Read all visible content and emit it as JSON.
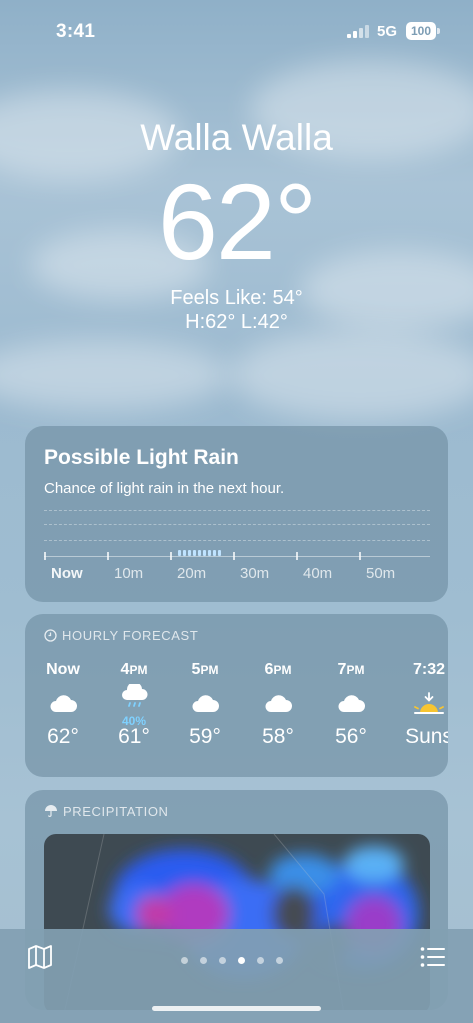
{
  "status": {
    "time": "3:41",
    "network": "5G",
    "battery": "100"
  },
  "location": {
    "city": "Walla Walla",
    "temperature": "62°",
    "feels_like": "Feels Like: 54°",
    "high_low": "H:62°  L:42°"
  },
  "rain_card": {
    "title": "Possible Light Rain",
    "subtitle": "Chance of light rain in the next hour.",
    "axis_labels": [
      "Now",
      "10m",
      "20m",
      "30m",
      "40m",
      "50m"
    ]
  },
  "hourly": {
    "header": "HOURLY FORECAST",
    "items": [
      {
        "time": "Now",
        "icon": "cloud-icon",
        "pop": "",
        "temp": "62°"
      },
      {
        "time": "4PM",
        "icon": "cloud-rain-icon",
        "pop": "40%",
        "temp": "61°"
      },
      {
        "time": "5PM",
        "icon": "cloud-icon",
        "pop": "",
        "temp": "59°"
      },
      {
        "time": "6PM",
        "icon": "cloud-icon",
        "pop": "",
        "temp": "58°"
      },
      {
        "time": "7PM",
        "icon": "cloud-icon",
        "pop": "",
        "temp": "56°"
      },
      {
        "time": "7:32",
        "icon": "sunset-icon",
        "pop": "",
        "temp": "Suns"
      }
    ]
  },
  "precipitation": {
    "header": "PRECIPITATION"
  },
  "pager": {
    "count": 6,
    "active": 3
  },
  "colors": {
    "rain_bar": "#bfe3ff",
    "pop_text": "#7fd1ff"
  }
}
